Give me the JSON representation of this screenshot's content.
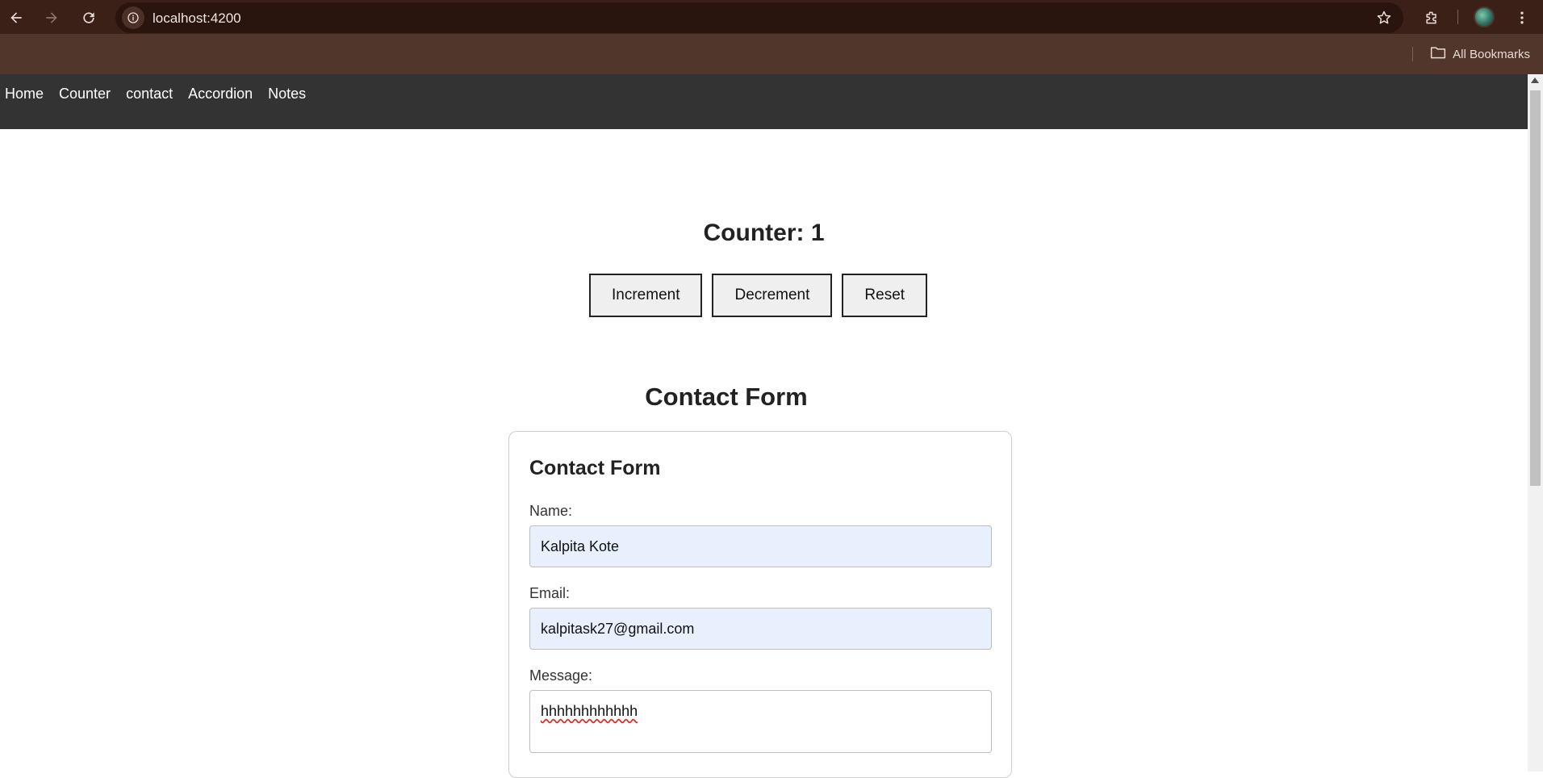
{
  "browser": {
    "url": "localhost:4200",
    "bookmarks_label": "All Bookmarks"
  },
  "nav": {
    "links": [
      "Home",
      "Counter",
      "contact",
      "Accordion",
      "Notes"
    ]
  },
  "counter": {
    "title": "Counter: 1",
    "increment_label": "Increment",
    "decrement_label": "Decrement",
    "reset_label": "Reset"
  },
  "contact": {
    "heading": "Contact Form",
    "card_title": "Contact Form",
    "name_label": "Name:",
    "name_value": "Kalpita Kote",
    "email_label": "Email:",
    "email_value": "kalpitask27@gmail.com",
    "message_label": "Message:",
    "message_value": "hhhhhhhhhhhh"
  }
}
